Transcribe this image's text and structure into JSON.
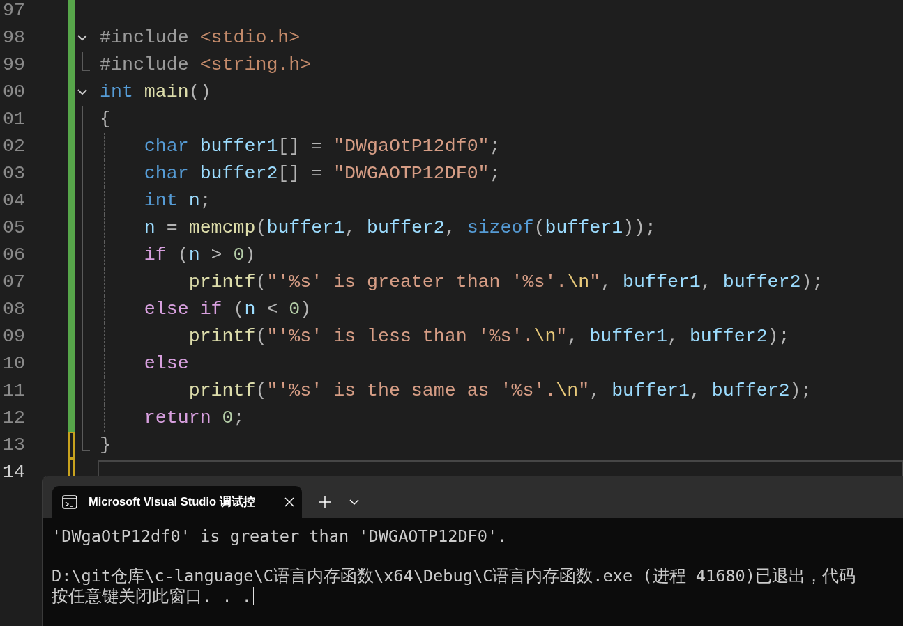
{
  "editor": {
    "lines": [
      {
        "number": "97",
        "saved": true,
        "fold_start": false,
        "fold_inside": false,
        "fold_end": false,
        "guide": false,
        "current": false
      },
      {
        "number": "98",
        "saved": true,
        "fold_start": true,
        "fold_inside": false,
        "fold_end": false,
        "guide": false,
        "current": false,
        "tokens": [
          {
            "kind": "preprocessor",
            "text": "#include"
          },
          {
            "kind": "include",
            "text": " <stdio.h>"
          }
        ]
      },
      {
        "number": "99",
        "saved": true,
        "fold_start": false,
        "fold_inside": false,
        "fold_end": true,
        "guide": false,
        "current": false,
        "tokens": [
          {
            "kind": "preprocessor",
            "text": "#include"
          },
          {
            "kind": "include",
            "text": " <string.h>"
          }
        ]
      },
      {
        "number": "00",
        "saved": true,
        "fold_start": true,
        "fold_inside": false,
        "fold_end": false,
        "guide": false,
        "current": false,
        "tokens": [
          {
            "kind": "keyword",
            "text": "int"
          },
          {
            "kind": "function",
            "text": " main"
          },
          {
            "kind": "punct",
            "text": "()"
          }
        ]
      },
      {
        "number": "01",
        "saved": true,
        "fold_start": false,
        "fold_inside": true,
        "fold_end": false,
        "guide": false,
        "current": false,
        "tokens": [
          {
            "kind": "punct",
            "text": "{"
          }
        ]
      },
      {
        "number": "02",
        "saved": true,
        "fold_start": false,
        "fold_inside": true,
        "fold_end": false,
        "guide": true,
        "current": false,
        "tokens": [
          {
            "kind": "keyword",
            "text": "    char"
          },
          {
            "kind": "variable",
            "text": " buffer1"
          },
          {
            "kind": "punct",
            "text": "[] = "
          },
          {
            "kind": "string",
            "text": "\"DWgaOtP12df0\""
          },
          {
            "kind": "punct",
            "text": ";"
          }
        ]
      },
      {
        "number": "03",
        "saved": true,
        "fold_start": false,
        "fold_inside": true,
        "fold_end": false,
        "guide": true,
        "current": false,
        "tokens": [
          {
            "kind": "keyword",
            "text": "    char"
          },
          {
            "kind": "variable",
            "text": " buffer2"
          },
          {
            "kind": "punct",
            "text": "[] = "
          },
          {
            "kind": "string",
            "text": "\"DWGAOTP12DF0\""
          },
          {
            "kind": "punct",
            "text": ";"
          }
        ]
      },
      {
        "number": "04",
        "saved": true,
        "fold_start": false,
        "fold_inside": true,
        "fold_end": false,
        "guide": true,
        "current": false,
        "tokens": [
          {
            "kind": "keyword",
            "text": "    int"
          },
          {
            "kind": "variable",
            "text": " n"
          },
          {
            "kind": "punct",
            "text": ";"
          }
        ]
      },
      {
        "number": "05",
        "saved": true,
        "fold_start": false,
        "fold_inside": true,
        "fold_end": false,
        "guide": true,
        "current": false,
        "tokens": [
          {
            "kind": "variable",
            "text": "    n"
          },
          {
            "kind": "punct",
            "text": " = "
          },
          {
            "kind": "function",
            "text": "memcmp"
          },
          {
            "kind": "punct",
            "text": "("
          },
          {
            "kind": "variable",
            "text": "buffer1"
          },
          {
            "kind": "punct",
            "text": ", "
          },
          {
            "kind": "variable",
            "text": "buffer2"
          },
          {
            "kind": "punct",
            "text": ", "
          },
          {
            "kind": "keyword",
            "text": "sizeof"
          },
          {
            "kind": "punct",
            "text": "("
          },
          {
            "kind": "variable",
            "text": "buffer1"
          },
          {
            "kind": "punct",
            "text": "));"
          }
        ]
      },
      {
        "number": "06",
        "saved": true,
        "fold_start": false,
        "fold_inside": true,
        "fold_end": false,
        "guide": true,
        "current": false,
        "tokens": [
          {
            "kind": "control",
            "text": "    if"
          },
          {
            "kind": "punct",
            "text": " ("
          },
          {
            "kind": "variable",
            "text": "n"
          },
          {
            "kind": "punct",
            "text": " > "
          },
          {
            "kind": "number",
            "text": "0"
          },
          {
            "kind": "punct",
            "text": ")"
          }
        ]
      },
      {
        "number": "07",
        "saved": true,
        "fold_start": false,
        "fold_inside": true,
        "fold_end": false,
        "guide": true,
        "current": false,
        "tokens": [
          {
            "kind": "function",
            "text": "        printf"
          },
          {
            "kind": "punct",
            "text": "("
          },
          {
            "kind": "string",
            "text": "\"'%s' is greater than '%s'."
          },
          {
            "kind": "escape",
            "text": "\\n"
          },
          {
            "kind": "string",
            "text": "\""
          },
          {
            "kind": "punct",
            "text": ", "
          },
          {
            "kind": "variable",
            "text": "buffer1"
          },
          {
            "kind": "punct",
            "text": ", "
          },
          {
            "kind": "variable",
            "text": "buffer2"
          },
          {
            "kind": "punct",
            "text": ");"
          }
        ]
      },
      {
        "number": "08",
        "saved": true,
        "fold_start": false,
        "fold_inside": true,
        "fold_end": false,
        "guide": true,
        "current": false,
        "tokens": [
          {
            "kind": "control",
            "text": "    else if"
          },
          {
            "kind": "punct",
            "text": " ("
          },
          {
            "kind": "variable",
            "text": "n"
          },
          {
            "kind": "punct",
            "text": " < "
          },
          {
            "kind": "number",
            "text": "0"
          },
          {
            "kind": "punct",
            "text": ")"
          }
        ]
      },
      {
        "number": "09",
        "saved": true,
        "fold_start": false,
        "fold_inside": true,
        "fold_end": false,
        "guide": true,
        "current": false,
        "tokens": [
          {
            "kind": "function",
            "text": "        printf"
          },
          {
            "kind": "punct",
            "text": "("
          },
          {
            "kind": "string",
            "text": "\"'%s' is less than '%s'."
          },
          {
            "kind": "escape",
            "text": "\\n"
          },
          {
            "kind": "string",
            "text": "\""
          },
          {
            "kind": "punct",
            "text": ", "
          },
          {
            "kind": "variable",
            "text": "buffer1"
          },
          {
            "kind": "punct",
            "text": ", "
          },
          {
            "kind": "variable",
            "text": "buffer2"
          },
          {
            "kind": "punct",
            "text": ");"
          }
        ]
      },
      {
        "number": "10",
        "saved": true,
        "fold_start": false,
        "fold_inside": true,
        "fold_end": false,
        "guide": true,
        "current": false,
        "tokens": [
          {
            "kind": "control",
            "text": "    else"
          }
        ]
      },
      {
        "number": "11",
        "saved": true,
        "fold_start": false,
        "fold_inside": true,
        "fold_end": false,
        "guide": true,
        "current": false,
        "tokens": [
          {
            "kind": "function",
            "text": "        printf"
          },
          {
            "kind": "punct",
            "text": "("
          },
          {
            "kind": "string",
            "text": "\"'%s' is the same as '%s'."
          },
          {
            "kind": "escape",
            "text": "\\n"
          },
          {
            "kind": "string",
            "text": "\""
          },
          {
            "kind": "punct",
            "text": ", "
          },
          {
            "kind": "variable",
            "text": "buffer1"
          },
          {
            "kind": "punct",
            "text": ", "
          },
          {
            "kind": "variable",
            "text": "buffer2"
          },
          {
            "kind": "punct",
            "text": ");"
          }
        ]
      },
      {
        "number": "12",
        "saved": true,
        "fold_start": false,
        "fold_inside": true,
        "fold_end": false,
        "guide": true,
        "current": false,
        "tokens": [
          {
            "kind": "control",
            "text": "    return"
          },
          {
            "kind": "number",
            "text": " 0"
          },
          {
            "kind": "punct",
            "text": ";"
          }
        ]
      },
      {
        "number": "13",
        "saved": false,
        "fold_start": false,
        "fold_inside": false,
        "fold_end": true,
        "guide": false,
        "current": false,
        "tokens": [
          {
            "kind": "punct",
            "text": "}"
          }
        ]
      },
      {
        "number": "14",
        "saved": false,
        "fold_start": false,
        "fold_inside": false,
        "fold_end": false,
        "guide": false,
        "current": true
      }
    ]
  },
  "terminal": {
    "tab": {
      "title": "Microsoft Visual Studio 调试控",
      "selected": true
    },
    "output_blocks": [
      [
        "'DWgaOtP12df0' is greater than 'DWGAOTP12DF0'."
      ],
      [
        "D:\\git仓库\\c-language\\C语言内存函数\\x64\\Debug\\C语言内存函数.exe (进程 41680)已退出，代码",
        "按任意键关闭此窗口. . ."
      ]
    ],
    "cursor": true
  }
}
